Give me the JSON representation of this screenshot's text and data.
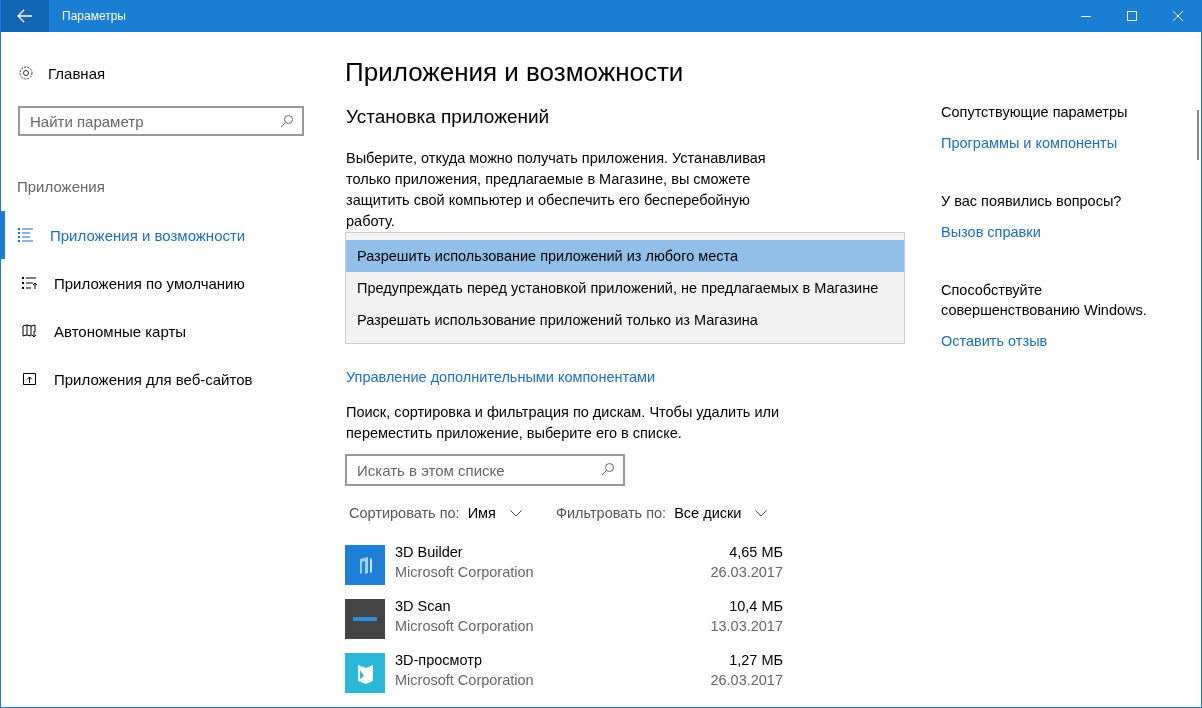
{
  "window": {
    "title": "Параметры"
  },
  "sidebar": {
    "home": "Главная",
    "search": {
      "placeholder": "Найти параметр"
    },
    "section": "Приложения",
    "items": [
      {
        "label": "Приложения и возможности",
        "kind": "list",
        "selected": true
      },
      {
        "label": "Приложения по умолчанию",
        "kind": "default",
        "selected": false
      },
      {
        "label": "Автономные карты",
        "kind": "map",
        "selected": false
      },
      {
        "label": "Приложения для веб-сайтов",
        "kind": "web",
        "selected": false
      }
    ]
  },
  "main": {
    "title": "Приложения и возможности",
    "install_heading": "Установка приложений",
    "install_text": "Выберите, откуда можно получать приложения. Устанавливая только приложения, предлагаемые в Магазине, вы сможете защитить свой компьютер и обеспечить его бесперебойную работу.",
    "dropdown_options": [
      {
        "label": "Разрешить использование приложений из любого места",
        "selected": true
      },
      {
        "label": "Предупреждать перед установкой приложений, не предлагаемых в Магазине",
        "selected": false
      },
      {
        "label": "Разрешать использование приложений только из Магазина",
        "selected": false
      }
    ],
    "manage_link": "Управление дополнительными компонентами",
    "search_text": "Поиск, сортировка и фильтрация по дискам. Чтобы удалить или переместить приложение, выберите его в списке.",
    "list_search": {
      "placeholder": "Искать в этом списке"
    },
    "sort": {
      "label": "Сортировать по:",
      "value": "Имя"
    },
    "filter": {
      "label": "Фильтровать по:",
      "value": "Все диски"
    },
    "apps": [
      {
        "name": "3D Builder",
        "publisher": "Microsoft Corporation",
        "size": "4,65 МБ",
        "date": "26.03.2017",
        "kind": "builder"
      },
      {
        "name": "3D Scan",
        "publisher": "Microsoft Corporation",
        "size": "10,4 МБ",
        "date": "13.03.2017",
        "kind": "scan"
      },
      {
        "name": "3D-просмотр",
        "publisher": "Microsoft Corporation",
        "size": "1,27 МБ",
        "date": "26.03.2017",
        "kind": "viewer"
      }
    ]
  },
  "related": [
    {
      "heading": "Сопутствующие параметры",
      "link": "Программы и компоненты"
    },
    {
      "heading": "У вас появились вопросы?",
      "link": "Вызов справки"
    },
    {
      "heading": "Способствуйте",
      "text": "совершенствованию Windows.",
      "link": "Оставить отзыв"
    }
  ]
}
